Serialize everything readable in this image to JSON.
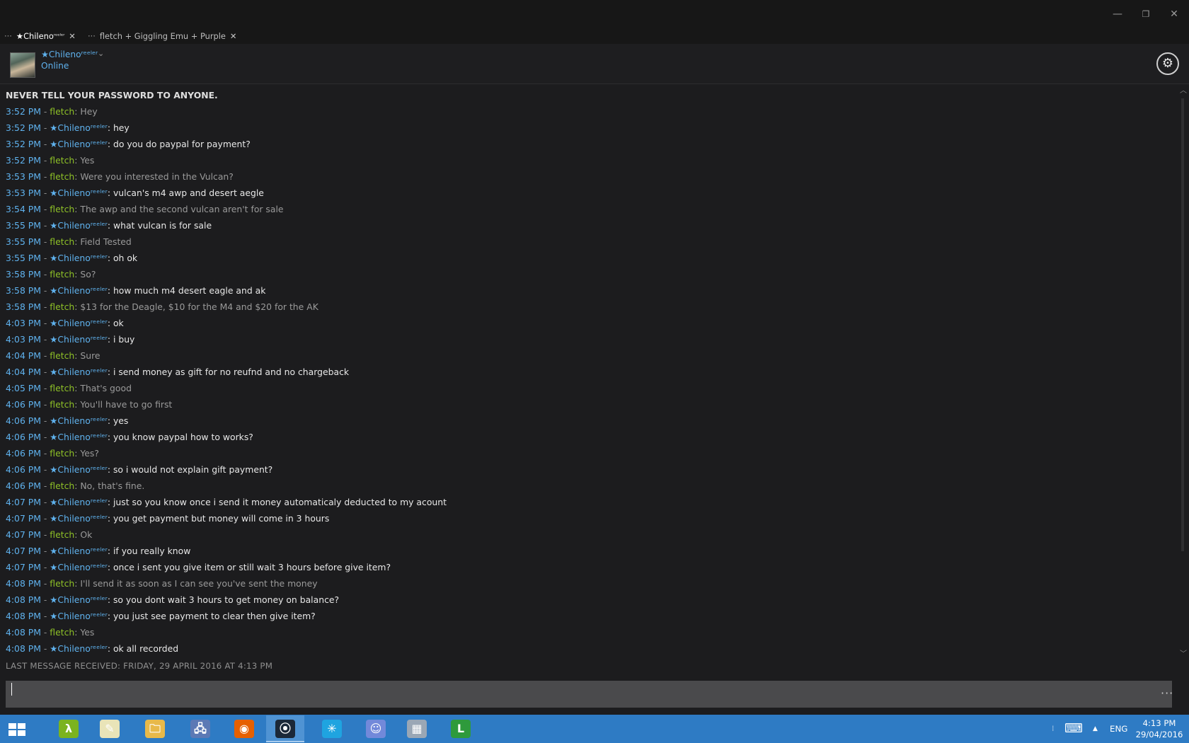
{
  "window": {
    "minimize": "—",
    "restore": "❐",
    "close": "✕"
  },
  "tabs": [
    {
      "label": "★Chileno",
      "dots": "···",
      "close": "✕"
    },
    {
      "label": "fletch + Giggling Emu + Purple",
      "dots": "···",
      "close": "✕"
    }
  ],
  "tab_suffix": "ʳᵉᵉˡᵉʳ",
  "profile": {
    "name": "★Chilenoʳᵉᵉˡᵉʳ",
    "status": "Online",
    "dropdown_icon": "chevron-down-icon"
  },
  "settings": {
    "icon": "gear-icon",
    "glyph": "⚙"
  },
  "chat": {
    "warning": "NEVER TELL YOUR PASSWORD TO ANYONE.",
    "users": {
      "fletch": "fletch",
      "chileno": "★Chilenoʳᵉᵉˡᵉʳ"
    },
    "messages": [
      {
        "time": "3:52 PM",
        "user": "fletch",
        "text": "Hey"
      },
      {
        "time": "3:52 PM",
        "user": "chileno",
        "text": "hey"
      },
      {
        "time": "3:52 PM",
        "user": "chileno",
        "text": "do you do paypal for payment?"
      },
      {
        "time": "3:52 PM",
        "user": "fletch",
        "text": "Yes"
      },
      {
        "time": "3:53 PM",
        "user": "fletch",
        "text": "Were you interested in the Vulcan?"
      },
      {
        "time": "3:53 PM",
        "user": "chileno",
        "text": "vulcan's m4 awp and desert aegle"
      },
      {
        "time": "3:54 PM",
        "user": "fletch",
        "text": "The awp and the second vulcan aren't for sale"
      },
      {
        "time": "3:55 PM",
        "user": "chileno",
        "text": "what vulcan is for sale"
      },
      {
        "time": "3:55 PM",
        "user": "fletch",
        "text": "Field Tested"
      },
      {
        "time": "3:55 PM",
        "user": "chileno",
        "text": "oh ok"
      },
      {
        "time": "3:58 PM",
        "user": "fletch",
        "text": "So?"
      },
      {
        "time": "3:58 PM",
        "user": "chileno",
        "text": "how much m4 desert eagle and ak"
      },
      {
        "time": "3:58 PM",
        "user": "fletch",
        "text": "$13 for the Deagle, $10 for the M4 and $20 for the AK"
      },
      {
        "time": "4:03 PM",
        "user": "chileno",
        "text": "ok"
      },
      {
        "time": "4:03 PM",
        "user": "chileno",
        "text": "i buy"
      },
      {
        "time": "4:04 PM",
        "user": "fletch",
        "text": "Sure"
      },
      {
        "time": "4:04 PM",
        "user": "chileno",
        "text": "i send money as gift for no reufnd and no chargeback"
      },
      {
        "time": "4:05 PM",
        "user": "fletch",
        "text": "That's good"
      },
      {
        "time": "4:06 PM",
        "user": "fletch",
        "text": "You'll have to go first"
      },
      {
        "time": "4:06 PM",
        "user": "chileno",
        "text": "yes"
      },
      {
        "time": "4:06 PM",
        "user": "chileno",
        "text": "you know paypal how to works?"
      },
      {
        "time": "4:06 PM",
        "user": "fletch",
        "text": "Yes?"
      },
      {
        "time": "4:06 PM",
        "user": "chileno",
        "text": "so i would not explain gift payment?"
      },
      {
        "time": "4:06 PM",
        "user": "fletch",
        "text": "No, that's fine."
      },
      {
        "time": "4:07 PM",
        "user": "chileno",
        "text": "just so you know once i send it money automaticaly deducted to my acount"
      },
      {
        "time": "4:07 PM",
        "user": "chileno",
        "text": "you get payment but money will come in 3 hours"
      },
      {
        "time": "4:07 PM",
        "user": "fletch",
        "text": "Ok"
      },
      {
        "time": "4:07 PM",
        "user": "chileno",
        "text": "if you really know"
      },
      {
        "time": "4:07 PM",
        "user": "chileno",
        "text": "once i sent you give item or still wait 3 hours before give item?"
      },
      {
        "time": "4:08 PM",
        "user": "fletch",
        "text": "I'll send it as soon as I can see you've sent the money"
      },
      {
        "time": "4:08 PM",
        "user": "chileno",
        "text": "so you dont wait 3 hours to get money on balance?"
      },
      {
        "time": "4:08 PM",
        "user": "chileno",
        "text": "you just see payment to clear then give item?"
      },
      {
        "time": "4:08 PM",
        "user": "fletch",
        "text": "Yes"
      },
      {
        "time": "4:08 PM",
        "user": "chileno",
        "text": "ok all recorded"
      }
    ],
    "last_received": "LAST MESSAGE RECEIVED: FRIDAY, 29 APRIL 2016 AT 4:13 PM"
  },
  "input": {
    "value": "",
    "placeholder": "",
    "more": "···"
  },
  "taskbar": {
    "apps": [
      {
        "name": "lambda-app-icon",
        "glyph": "λ",
        "color": "#7bb31f"
      },
      {
        "name": "notepad-chart-icon",
        "glyph": "✎",
        "color": "#e9e4b8"
      },
      {
        "name": "file-explorer-icon",
        "glyph": "🗀",
        "color": "#e8b94a"
      },
      {
        "name": "network-computer-icon",
        "glyph": "🖧",
        "color": "#5c79b5"
      },
      {
        "name": "firefox-icon",
        "glyph": "◉",
        "color": "#e66000"
      },
      {
        "name": "steam-icon",
        "glyph": "⦿",
        "color": "#1b2838"
      },
      {
        "name": "spinner-app-icon",
        "glyph": "✳",
        "color": "#1fa4e0"
      },
      {
        "name": "discord-icon",
        "glyph": "☺",
        "color": "#7289da"
      },
      {
        "name": "photos-icon",
        "glyph": "▦",
        "color": "#9aa7b5"
      },
      {
        "name": "driving-test-icon",
        "glyph": "L",
        "color": "#2e9a3c"
      }
    ],
    "language": "ENG",
    "tray_arrow": "▲",
    "clock_time": "4:13 PM",
    "clock_date": "29/04/2016"
  }
}
